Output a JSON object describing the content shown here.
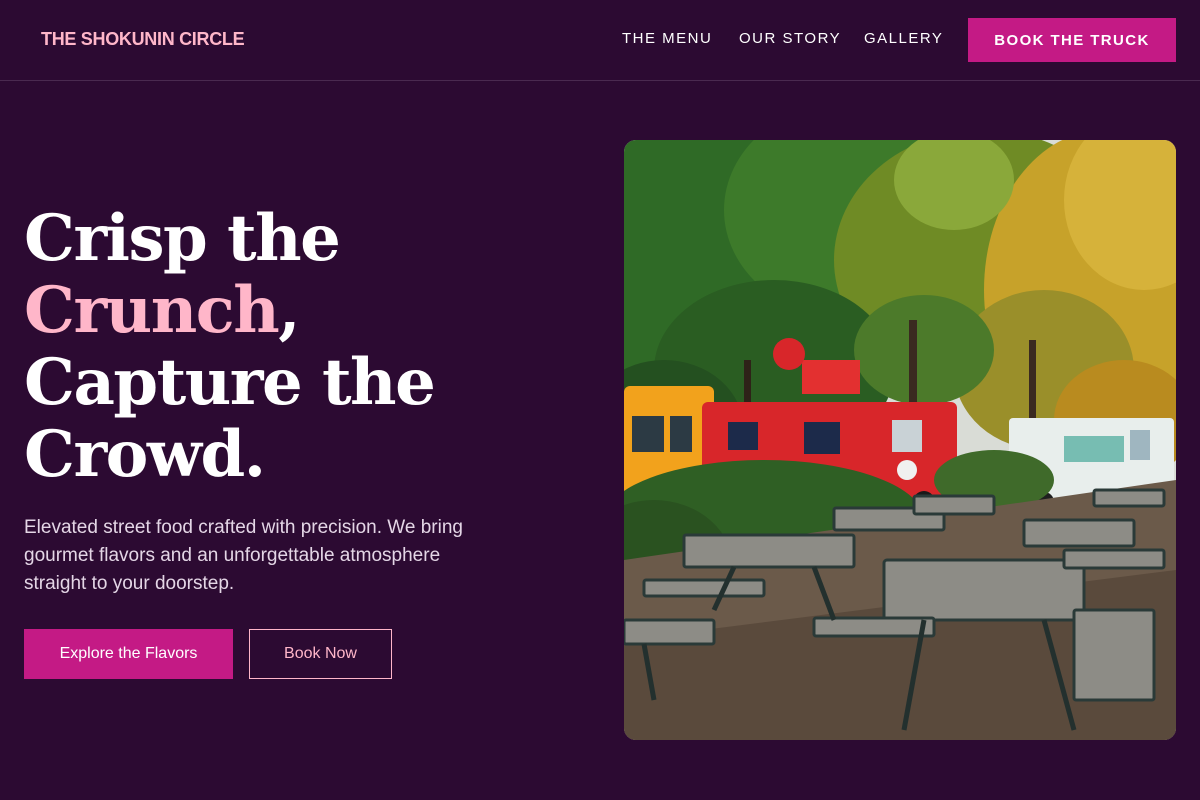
{
  "header": {
    "logo": "THE SHOKUNIN CIRCLE",
    "nav": {
      "menu": "THE MENU",
      "story": "OUR STORY",
      "gallery": "GALLERY"
    },
    "cta": "BOOK THE TRUCK"
  },
  "hero": {
    "headline": {
      "line1": "Crisp the",
      "accent": "Crunch",
      "comma": ",",
      "line3": "Capture the",
      "line4": "Crowd."
    },
    "subtitle": "Elevated street food crafted with precision. We bring gourmet flavors and an unforgettable atmosphere straight to your doorstep.",
    "primary_button": "Explore the Flavors",
    "secondary_button": "Book Now",
    "image_alt": "Food trucks parked beside picnic tables under autumn trees"
  },
  "colors": {
    "background": "#2c0a32",
    "accent_pink": "#ffb6c9",
    "brand_magenta": "#c41a85",
    "text": "#ffffff"
  }
}
